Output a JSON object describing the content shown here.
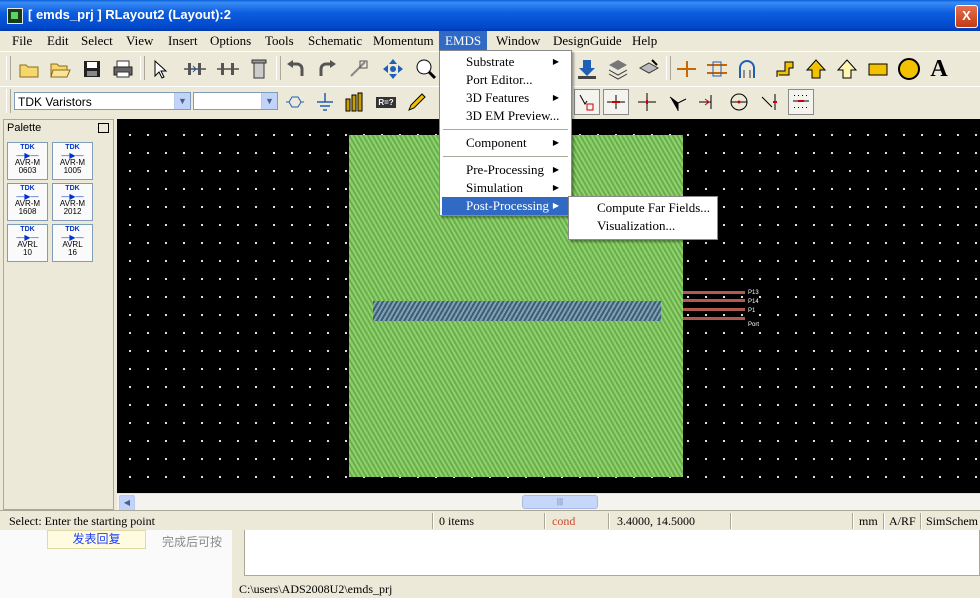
{
  "window": {
    "title": "[ emds_prj ] RLayout2 (Layout):2",
    "close_glyph": "X"
  },
  "menubar": {
    "items": [
      "File",
      "Edit",
      "Select",
      "View",
      "Insert",
      "Options",
      "Tools",
      "Schematic",
      "Momentum",
      "EMDS",
      "Window",
      "DesignGuide",
      "Help"
    ],
    "active": "EMDS"
  },
  "toolbar": {
    "component_library": "TDK Varistors",
    "component_select": "",
    "icons1": [
      "new-icon",
      "open-icon",
      "save-icon",
      "print-icon",
      "select-pointer-icon",
      "insert-port-icon",
      "insert-pin-icon",
      "delete-icon",
      "undo-icon",
      "redo-icon",
      "stretch-icon",
      "move-icon",
      "zoom-area-icon",
      "download-icon",
      "layers-stack-icon",
      "layer-edit-icon",
      "trace-icon",
      "align-icon",
      "route-icon",
      "polyline-icon",
      "arrow-icon",
      "diamond-icon",
      "rectangle-icon",
      "circle-icon",
      "text-icon"
    ],
    "icons2": [
      "hexagon-icon",
      "ground-icon",
      "component-bars-icon",
      "r-component-icon",
      "pencil-icon",
      "snap-icon",
      "vertex-icon",
      "cross-icon",
      "tee-icon",
      "endpoint-icon",
      "crosshair-icon",
      "edge-icon",
      "grid-snap-icon"
    ],
    "r_component_text": "R=?"
  },
  "palette": {
    "title": "Palette",
    "items": [
      {
        "brand": "TDK",
        "line1": "AVR-M",
        "line2": "0603"
      },
      {
        "brand": "TDK",
        "line1": "AVR-M",
        "line2": "1005"
      },
      {
        "brand": "TDK",
        "line1": "AVR-M",
        "line2": "1608"
      },
      {
        "brand": "TDK",
        "line1": "AVR-M",
        "line2": "2012"
      },
      {
        "brand": "TDK",
        "line1": "AVRL",
        "line2": "10"
      },
      {
        "brand": "TDK",
        "line1": "AVRL",
        "line2": "16"
      }
    ]
  },
  "emds_menu": {
    "items": [
      {
        "label": "Substrate",
        "submenu": true
      },
      {
        "label": "Port Editor...",
        "submenu": false
      },
      {
        "label": "3D Features",
        "submenu": true
      },
      {
        "label": "3D EM Preview...",
        "submenu": false
      },
      {
        "label": "Component",
        "submenu": true
      },
      {
        "label": "Pre-Processing",
        "submenu": true
      },
      {
        "label": "Simulation",
        "submenu": true
      },
      {
        "label": "Post-Processing",
        "submenu": true
      }
    ],
    "highlighted": "Post-Processing",
    "post_processing_submenu": [
      "Compute Far Fields...",
      "Visualization..."
    ]
  },
  "canvas": {
    "port_labels": [
      "P13",
      "P14",
      "P1",
      "Port"
    ]
  },
  "statusbar": {
    "prompt": "Select: Enter the starting point",
    "items": "0 items",
    "layer": "cond",
    "coordinates": "3.4000, 14.5000",
    "units": "mm",
    "mode": "A/RF",
    "simulator": "SimSchem"
  },
  "background": {
    "reply_button": "发表回复",
    "done_text": "完成后可按",
    "path": "C:\\users\\ADS2008U2\\emds_prj"
  },
  "colors": {
    "titlebar": "#0047c9",
    "menu_highlight": "#316ac5",
    "board": "#8fd16a",
    "strip": "#3e5f72",
    "lead": "#b05a52",
    "status_layer": "#d14a2a"
  }
}
